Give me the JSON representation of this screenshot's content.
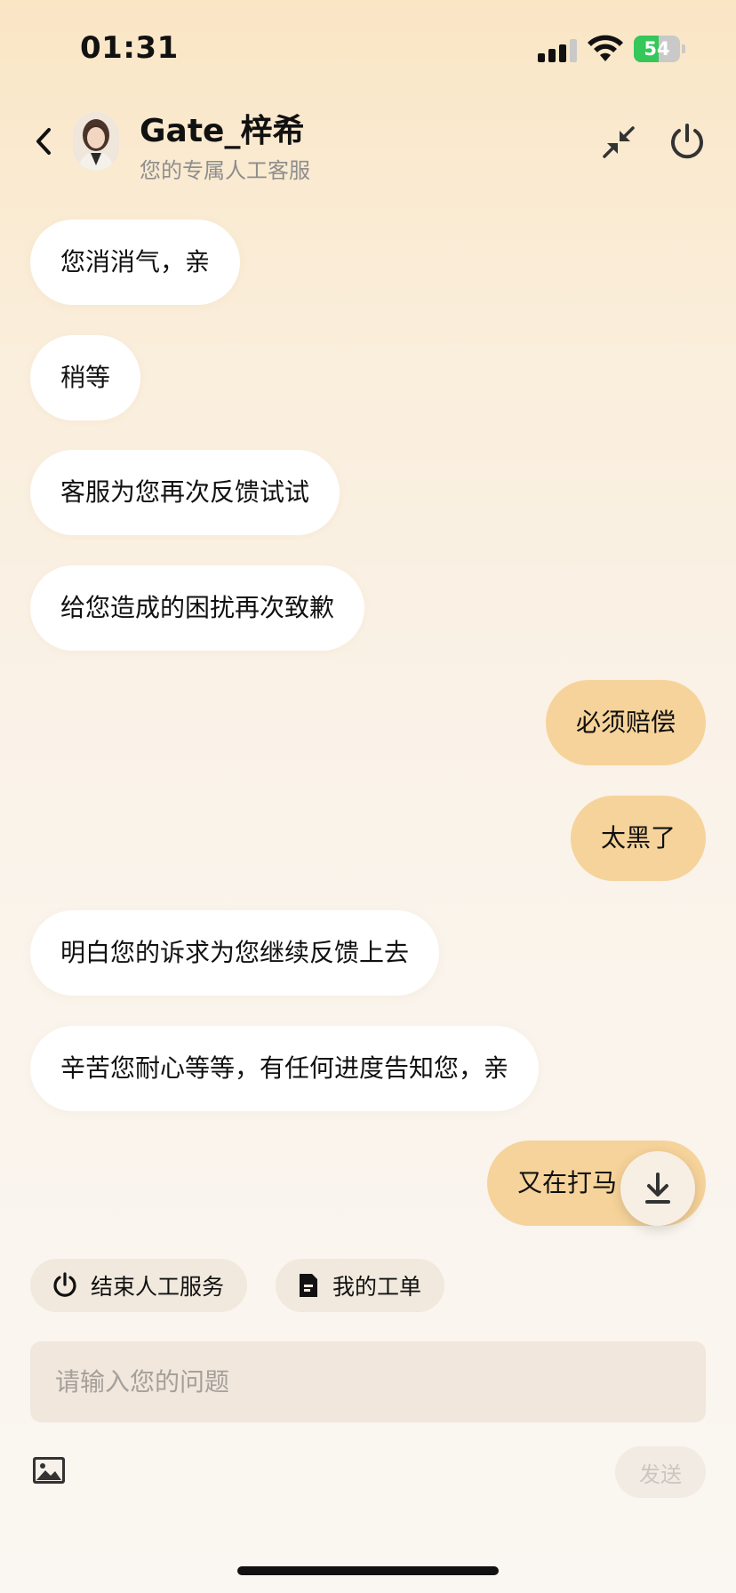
{
  "status_bar": {
    "time": "01:31",
    "battery_percent": "54",
    "battery_level": 0.54
  },
  "header": {
    "agent_name": "Gate_梓希",
    "agent_subtitle": "您的专属人工客服",
    "back_icon": "chevron-left-icon",
    "minimize_icon": "collapse-arrows-icon",
    "power_icon": "power-icon"
  },
  "messages": [
    {
      "side": "in",
      "text": "您消消气，亲"
    },
    {
      "side": "in",
      "text": "稍等"
    },
    {
      "side": "in",
      "text": "客服为您再次反馈试试"
    },
    {
      "side": "in",
      "text": "给您造成的困扰再次致歉"
    },
    {
      "side": "out",
      "text": "必须赔偿"
    },
    {
      "side": "out",
      "text": "太黑了"
    },
    {
      "side": "in",
      "text": "明白您的诉求为您继续反馈上去"
    },
    {
      "side": "in",
      "text": "辛苦您耐心等等，有任何进度告知您，亲"
    },
    {
      "side": "out",
      "text": "又在打马"
    }
  ],
  "quick_actions": {
    "end_service_label": "结束人工服务",
    "my_tickets_label": "我的工单"
  },
  "composer": {
    "placeholder": "请输入您的问题",
    "value": "",
    "send_label": "发送",
    "image_icon": "image-icon"
  },
  "colors": {
    "outgoing_bubble": "#f6d39a",
    "incoming_bubble": "#ffffff",
    "header_bg": "#fae6c5",
    "battery_green": "#35c759"
  }
}
